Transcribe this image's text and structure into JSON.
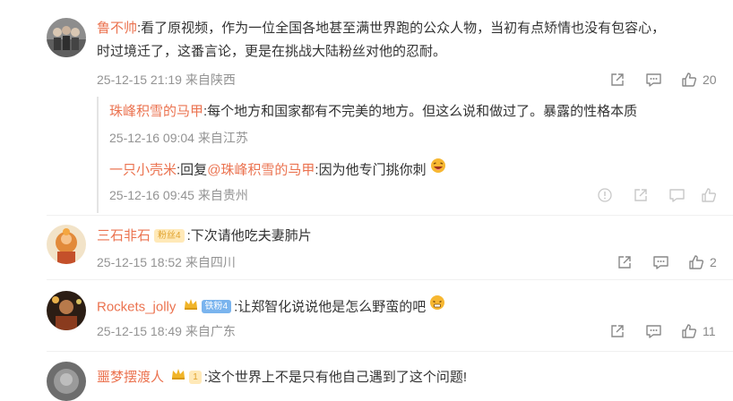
{
  "comments": [
    {
      "user": "鲁不帅",
      "text_line1": ":看了原视频，作为一位全国各地甚至满世界跑的公众人物，当初有点矫情也没有包容心，",
      "text_line2": "时过境迁了，这番言论，更是在挑战大陆粉丝对他的忍耐。",
      "timestamp": "25-12-15 21:19",
      "location": "来自陕西",
      "likes": "20",
      "replies": [
        {
          "user": "珠峰积雪的马甲",
          "text": ":每个地方和国家都有不完美的地方。但这么说和做过了。暴露的性格本质",
          "timestamp": "25-12-16 09:04",
          "location": "来自江苏"
        },
        {
          "user": "一只小壳米",
          "reply_prefix": ":回复",
          "mention": "@珠峰积雪的马甲",
          "text": ":因为他专门挑你刺",
          "timestamp": "25-12-16 09:45",
          "location": "来自贵州"
        }
      ]
    },
    {
      "user": "三石非石",
      "badge": "粉丝4",
      "text": ":下次请他吃夫妻肺片",
      "timestamp": "25-12-15 18:52",
      "location": "来自四川",
      "likes": "2"
    },
    {
      "user": "Rockets_jolly",
      "badge": "铁粉4",
      "text": ":让郑智化说说他是怎么野蛮的吧",
      "timestamp": "25-12-15 18:49",
      "location": "来自广东",
      "likes": "11"
    },
    {
      "user": "噩梦摆渡人",
      "badge": "1",
      "text": ":这个世界上不是只有他自己遇到了这个问题!"
    }
  ],
  "colors": {
    "username": "#eb7350",
    "meta": "#939393",
    "icon": "#888888"
  },
  "icons": [
    "share-icon",
    "comment-icon",
    "like-icon",
    "report-icon"
  ]
}
